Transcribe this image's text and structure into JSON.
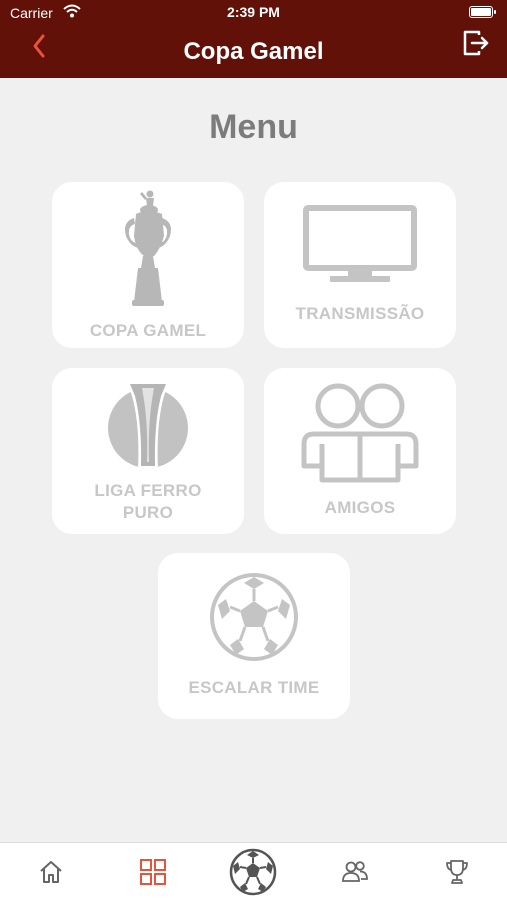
{
  "status_bar": {
    "carrier": "Carrier",
    "time": "2:39 PM"
  },
  "nav": {
    "title": "Copa Gamel"
  },
  "menu": {
    "title": "Menu",
    "items": [
      {
        "label": "COPA GAMEL",
        "icon": "trophy-icon"
      },
      {
        "label": "TRANSMISSÃO",
        "icon": "tv-icon"
      },
      {
        "label": "LIGA FERRO PURO",
        "icon": "league-icon"
      },
      {
        "label": "AMIGOS",
        "icon": "friends-icon"
      },
      {
        "label": "ESCALAR TIME",
        "icon": "soccer-ball-icon"
      }
    ]
  },
  "tab_bar": {
    "tabs": [
      {
        "icon": "home-icon"
      },
      {
        "icon": "grid-icon",
        "active": true
      },
      {
        "icon": "soccer-ball-icon"
      },
      {
        "icon": "friends-icon"
      },
      {
        "icon": "trophy-icon"
      }
    ]
  },
  "colors": {
    "primary": "#621108",
    "accent": "#e8533e",
    "card_text": "#c7c7c7",
    "title_text": "#7c7c7c"
  }
}
